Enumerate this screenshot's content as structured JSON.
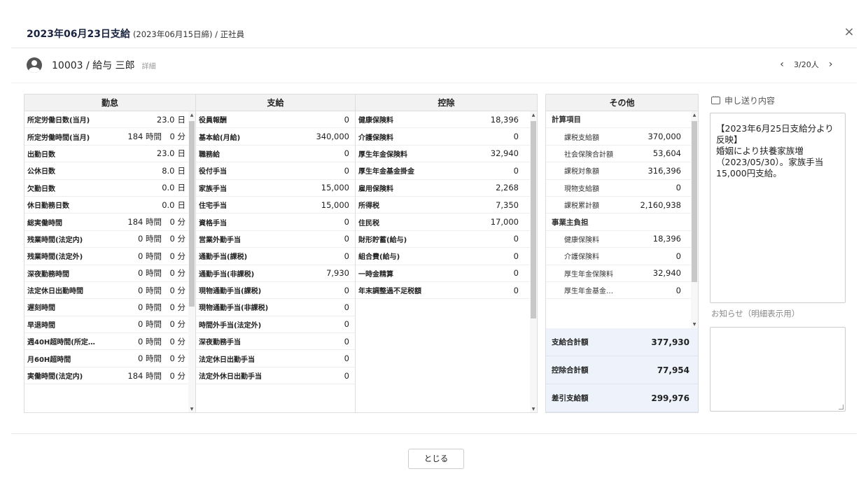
{
  "header": {
    "title": "2023年06月23日支給",
    "subtitle": "(2023年06月15日締) / 正社員",
    "close_icon": "×"
  },
  "employee": {
    "name": "10003 / 給与 三郎",
    "detail_link": "詳細",
    "pager": {
      "prev": "‹",
      "count": "3/20人",
      "next": "›"
    }
  },
  "kintai": {
    "title": "勤怠",
    "rows": [
      {
        "label": "所定労働日数(当月)",
        "value": "23.0",
        "unit": "日"
      },
      {
        "label": "所定労働時間(当月)",
        "hours": "184 時間",
        "minutes": "0 分"
      },
      {
        "label": "出勤日数",
        "value": "23.0",
        "unit": "日"
      },
      {
        "label": "公休日数",
        "value": "8.0",
        "unit": "日"
      },
      {
        "label": "欠勤日数",
        "value": "0.0",
        "unit": "日"
      },
      {
        "label": "休日勤務日数",
        "value": "0.0",
        "unit": "日"
      },
      {
        "label": "総実働時間",
        "hours": "184 時間",
        "minutes": "0 分"
      },
      {
        "label": "残業時間(法定内)",
        "hours": "0 時間",
        "minutes": "0 分"
      },
      {
        "label": "残業時間(法定外)",
        "hours": "0 時間",
        "minutes": "0 分"
      },
      {
        "label": "深夜勤務時間",
        "hours": "0 時間",
        "minutes": "0 分"
      },
      {
        "label": "法定休日出勤時間",
        "hours": "0 時間",
        "minutes": "0 分"
      },
      {
        "label": "遅刻時間",
        "hours": "0 時間",
        "minutes": "0 分"
      },
      {
        "label": "早退時間",
        "hours": "0 時間",
        "minutes": "0 分"
      },
      {
        "label": "週40H超時間(所定…",
        "hours": "0 時間",
        "minutes": "0 分"
      },
      {
        "label": "月60H超時間",
        "hours": "0 時間",
        "minutes": "0 分"
      },
      {
        "label": "実働時間(法定内)",
        "hours": "184 時間",
        "minutes": "0 分"
      }
    ]
  },
  "shikyu": {
    "title": "支給",
    "rows": [
      {
        "label": "役員報酬",
        "value": "0"
      },
      {
        "label": "基本給(月給)",
        "value": "340,000"
      },
      {
        "label": "職務給",
        "value": "0"
      },
      {
        "label": "役付手当",
        "value": "0"
      },
      {
        "label": "家族手当",
        "value": "15,000"
      },
      {
        "label": "住宅手当",
        "value": "15,000"
      },
      {
        "label": "資格手当",
        "value": "0"
      },
      {
        "label": "営業外勤手当",
        "value": "0"
      },
      {
        "label": "通勤手当(課税)",
        "value": "0"
      },
      {
        "label": "通勤手当(非課税)",
        "value": "7,930"
      },
      {
        "label": "現物通勤手当(課税)",
        "value": "0"
      },
      {
        "label": "現物通勤手当(非課税)",
        "value": "0"
      },
      {
        "label": "時間外手当(法定外)",
        "value": "0"
      },
      {
        "label": "深夜勤務手当",
        "value": "0"
      },
      {
        "label": "法定休日出勤手当",
        "value": "0"
      },
      {
        "label": "法定外休日出勤手当",
        "value": "0"
      }
    ]
  },
  "kojo": {
    "title": "控除",
    "rows": [
      {
        "label": "健康保険料",
        "value": "18,396"
      },
      {
        "label": "介護保険料",
        "value": "0"
      },
      {
        "label": "厚生年金保険料",
        "value": "32,940"
      },
      {
        "label": "厚生年金基金掛金",
        "value": "0"
      },
      {
        "label": "雇用保険料",
        "value": "2,268"
      },
      {
        "label": "所得税",
        "value": "7,350"
      },
      {
        "label": "住民税",
        "value": "17,000"
      },
      {
        "label": "財形貯蓄(給与)",
        "value": "0"
      },
      {
        "label": "組合費(給与)",
        "value": "0"
      },
      {
        "label": "一時金精算",
        "value": "0"
      },
      {
        "label": "年末調整過不足税額",
        "value": "0"
      }
    ]
  },
  "sonota": {
    "title": "その他",
    "section1": "計算項目",
    "rows1": [
      {
        "label": "課税支給額",
        "value": "370,000"
      },
      {
        "label": "社会保険合計額",
        "value": "53,604"
      },
      {
        "label": "課税対象額",
        "value": "316,396"
      },
      {
        "label": "現物支給額",
        "value": "0"
      },
      {
        "label": "課税累計額",
        "value": "2,160,938"
      }
    ],
    "section2": "事業主負担",
    "rows2": [
      {
        "label": "健康保険料",
        "value": "18,396"
      },
      {
        "label": "介護保険料",
        "value": "0"
      },
      {
        "label": "厚生年金保険料",
        "value": "32,940"
      },
      {
        "label": "厚生年金基金…",
        "value": "0"
      }
    ],
    "totals": [
      {
        "label": "支給合計額",
        "value": "377,930"
      },
      {
        "label": "控除合計額",
        "value": "77,954"
      },
      {
        "label": "差引支給額",
        "value": "299,976"
      }
    ]
  },
  "memo": {
    "label": "申し送り内容",
    "text": "【2023年6月25日支給分より反映】\n婚姻により扶養家族増（2023/05/30）。家族手当15,000円支給。"
  },
  "notice": {
    "label": "お知らせ（明細表示用）",
    "text": ""
  },
  "footer": {
    "close_button": "とじる"
  }
}
